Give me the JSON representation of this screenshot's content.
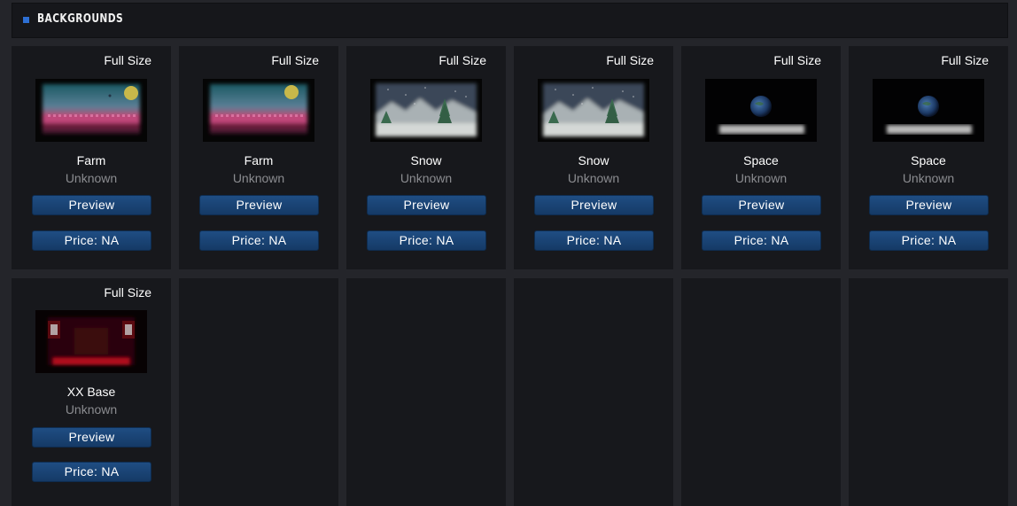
{
  "section": {
    "title": "BACKGROUNDS",
    "accent_color": "#2d6fd3"
  },
  "items": [
    {
      "name": "Farm",
      "author": "Unknown",
      "full_size_label": "Full Size",
      "preview_label": "Preview",
      "price_label": "Price: NA",
      "theme": "farm"
    },
    {
      "name": "Farm",
      "author": "Unknown",
      "full_size_label": "Full Size",
      "preview_label": "Preview",
      "price_label": "Price: NA",
      "theme": "farm"
    },
    {
      "name": "Snow",
      "author": "Unknown",
      "full_size_label": "Full Size",
      "preview_label": "Preview",
      "price_label": "Price: NA",
      "theme": "snow"
    },
    {
      "name": "Snow",
      "author": "Unknown",
      "full_size_label": "Full Size",
      "preview_label": "Preview",
      "price_label": "Price: NA",
      "theme": "snow"
    },
    {
      "name": "Space",
      "author": "Unknown",
      "full_size_label": "Full Size",
      "preview_label": "Preview",
      "price_label": "Price: NA",
      "theme": "space"
    },
    {
      "name": "Space",
      "author": "Unknown",
      "full_size_label": "Full Size",
      "preview_label": "Preview",
      "price_label": "Price: NA",
      "theme": "space"
    },
    {
      "name": "XX Base",
      "author": "Unknown",
      "full_size_label": "Full Size",
      "preview_label": "Preview",
      "price_label": "Price: NA",
      "theme": "xxbase"
    }
  ]
}
